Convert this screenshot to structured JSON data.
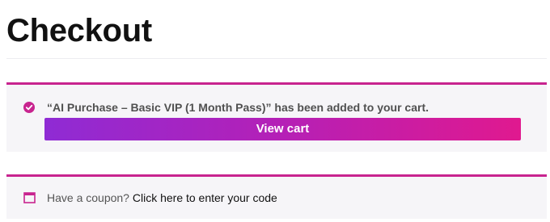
{
  "page": {
    "title": "Checkout"
  },
  "cart_notice": {
    "message": "“AI Purchase – Basic VIP (1 Month Pass)” has been added to your cart.",
    "button_label": "View cart",
    "icon": "check-circle-icon"
  },
  "coupon_notice": {
    "prompt": "Have a coupon?",
    "link_text": "Click here to enter your code",
    "icon": "coupon-window-icon"
  },
  "colors": {
    "accent": "#c8248f",
    "button_gradient_start": "#8f2bd4",
    "button_gradient_end": "#e0198f",
    "notice_background": "#f6f5f8"
  }
}
